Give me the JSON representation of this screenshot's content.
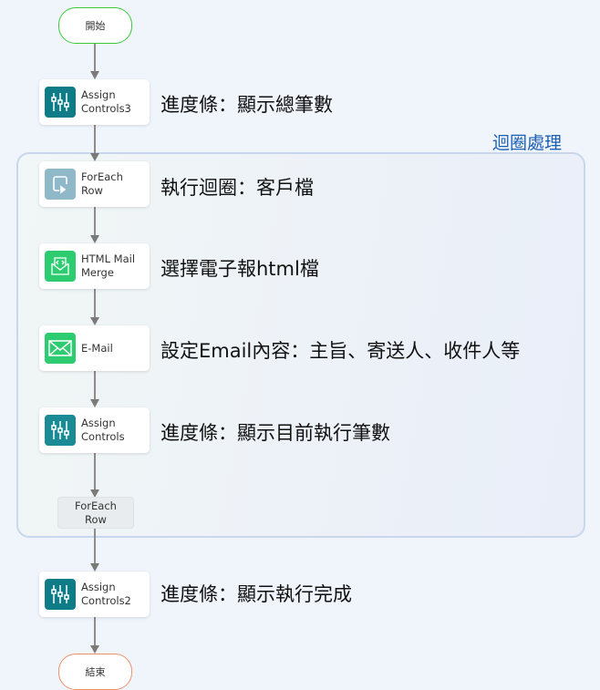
{
  "start": "開始",
  "end": "結束",
  "loop": {
    "label": "迴圈處理",
    "end_label": "ForEach\nRow"
  },
  "nodes": [
    {
      "label": "Assign\nControls3",
      "icon": "sliders-icon",
      "note": "進度條：顯示總筆數"
    },
    {
      "label": "ForEach\nRow",
      "icon": "foreach-icon",
      "note": "執行迴圈：客戶檔"
    },
    {
      "label": "HTML Mail\nMerge",
      "icon": "html-mail-icon",
      "note": "選擇電子報html檔"
    },
    {
      "label": "E-Mail",
      "icon": "envelope-icon",
      "note": "設定Email內容：主旨、寄送人、收件人等"
    },
    {
      "label": "Assign\nControls",
      "icon": "sliders-icon",
      "note": "進度條：顯示目前執行筆數"
    },
    {
      "label": "Assign\nControls2",
      "icon": "sliders-icon",
      "note": "進度條：顯示執行完成"
    }
  ],
  "colors": {
    "start_border": "#3cc83c",
    "end_border": "#f0906a",
    "assign": "#0e7c86",
    "foreach": "#8fb8c8",
    "mail": "#2ecc71",
    "loop_label": "#1a5fb4"
  }
}
